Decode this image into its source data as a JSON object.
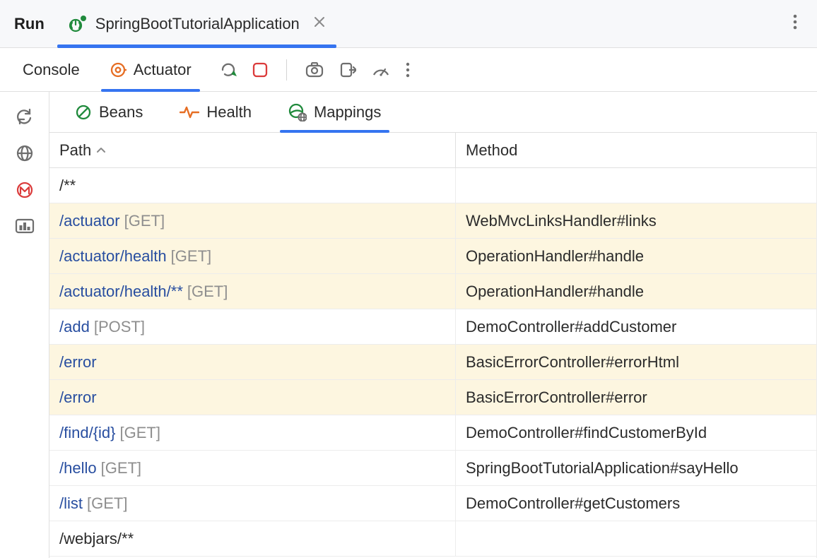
{
  "header": {
    "run_label": "Run",
    "app_tab_label": "SpringBootTutorialApplication"
  },
  "sub_tabs": {
    "console": "Console",
    "actuator": "Actuator"
  },
  "cat_tabs": {
    "beans": "Beans",
    "health": "Health",
    "mappings": "Mappings"
  },
  "table": {
    "headers": {
      "path": "Path",
      "method": "Method"
    },
    "rows": [
      {
        "path": "/**",
        "verb": "",
        "method": "",
        "hl": false,
        "plain": true
      },
      {
        "path": "/actuator",
        "verb": "[GET]",
        "method": "WebMvcLinksHandler#links",
        "hl": true,
        "plain": false
      },
      {
        "path": "/actuator/health",
        "verb": "[GET]",
        "method": "OperationHandler#handle",
        "hl": true,
        "plain": false
      },
      {
        "path": "/actuator/health/**",
        "verb": "[GET]",
        "method": "OperationHandler#handle",
        "hl": true,
        "plain": false
      },
      {
        "path": "/add",
        "verb": "[POST]",
        "method": "DemoController#addCustomer",
        "hl": false,
        "plain": false
      },
      {
        "path": "/error",
        "verb": "",
        "method": "BasicErrorController#errorHtml",
        "hl": true,
        "plain": false
      },
      {
        "path": "/error",
        "verb": "",
        "method": "BasicErrorController#error",
        "hl": true,
        "plain": false
      },
      {
        "path": "/find/{id}",
        "verb": "[GET]",
        "method": "DemoController#findCustomerById",
        "hl": false,
        "plain": false
      },
      {
        "path": "/hello",
        "verb": "[GET]",
        "method": "SpringBootTutorialApplication#sayHello",
        "hl": false,
        "plain": false
      },
      {
        "path": "/list",
        "verb": "[GET]",
        "method": "DemoController#getCustomers",
        "hl": false,
        "plain": false
      },
      {
        "path": "/webjars/**",
        "verb": "",
        "method": "",
        "hl": false,
        "plain": true
      }
    ]
  }
}
